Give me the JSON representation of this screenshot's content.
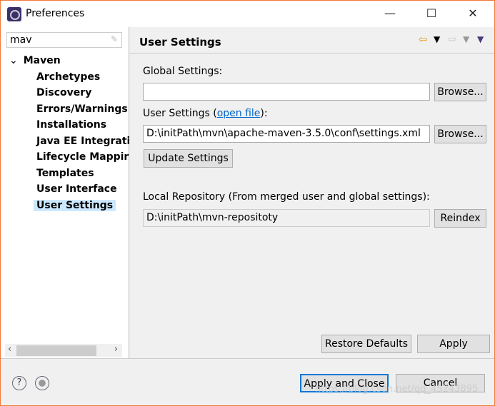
{
  "window": {
    "title": "Preferences",
    "minimize": "—",
    "maximize": "☐",
    "close": "✕"
  },
  "search": {
    "value": "mav",
    "clear_icon": "eraser-icon"
  },
  "tree": {
    "root": "Maven",
    "items": [
      "Archetypes",
      "Discovery",
      "Errors/Warnings",
      "Installations",
      "Java EE Integrati",
      "Lifecycle Mappir",
      "Templates",
      "User Interface",
      "User Settings"
    ],
    "selected": "User Settings"
  },
  "page": {
    "title": "User Settings",
    "global_label": "Global Settings:",
    "global_value": "",
    "user_label_prefix": "User Settings (",
    "user_link": "open file",
    "user_label_suffix": "):",
    "user_value": "D:\\initPath\\mvn\\apache-maven-3.5.0\\conf\\settings.xml",
    "browse": "Browse...",
    "update": "Update Settings",
    "local_label": "Local Repository (From merged user and global settings):",
    "local_value": "D:\\initPath\\mvn-repositoty",
    "reindex": "Reindex",
    "restore": "Restore Defaults",
    "apply": "Apply"
  },
  "footer": {
    "apply_close": "Apply and Close",
    "cancel": "Cancel",
    "help": "?",
    "watermark": "https://blog.csdn.net/qq_45243895"
  },
  "colors": {
    "accent": "#0078d7",
    "selection": "#cce8ff",
    "border": "#f07a3a"
  }
}
